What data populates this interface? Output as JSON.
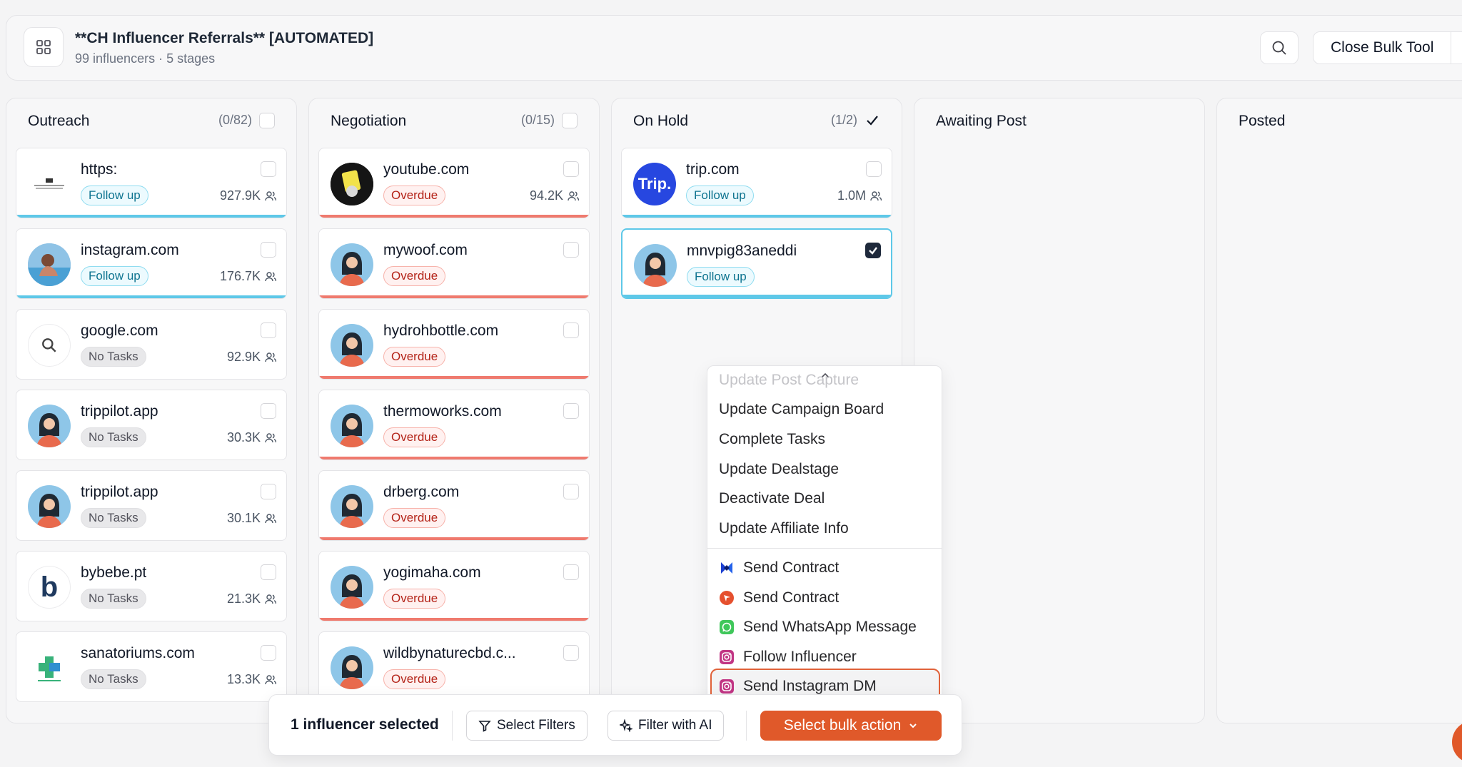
{
  "header": {
    "title": "**CH Influencer Referrals** [AUTOMATED]",
    "subtitle": "99 influencers · 5 stages",
    "close_label": "Close Bulk Tool"
  },
  "columns": [
    {
      "title": "Outreach",
      "count": "(0/82)"
    },
    {
      "title": "Negotiation",
      "count": "(0/15)"
    },
    {
      "title": "On Hold",
      "count": "(1/2)"
    },
    {
      "title": "Awaiting Post",
      "count": ""
    },
    {
      "title": "Posted",
      "count": ""
    }
  ],
  "outreach": [
    {
      "name": "https:",
      "status": "Follow up",
      "followers": "927.9K"
    },
    {
      "name": "instagram.com",
      "status": "Follow up",
      "followers": "176.7K"
    },
    {
      "name": "google.com",
      "status": "No Tasks",
      "followers": "92.9K"
    },
    {
      "name": "trippilot.app",
      "status": "No Tasks",
      "followers": "30.3K"
    },
    {
      "name": "trippilot.app",
      "status": "No Tasks",
      "followers": "30.1K"
    },
    {
      "name": "bybebe.pt",
      "status": "No Tasks",
      "followers": "21.3K"
    },
    {
      "name": "sanatoriums.com",
      "status": "No Tasks",
      "followers": "13.3K"
    }
  ],
  "negotiation": [
    {
      "name": "youtube.com",
      "status": "Overdue",
      "followers": "94.2K"
    },
    {
      "name": "mywoof.com",
      "status": "Overdue",
      "followers": ""
    },
    {
      "name": "hydrohbottle.com",
      "status": "Overdue",
      "followers": ""
    },
    {
      "name": "thermoworks.com",
      "status": "Overdue",
      "followers": ""
    },
    {
      "name": "drberg.com",
      "status": "Overdue",
      "followers": ""
    },
    {
      "name": "yogimaha.com",
      "status": "Overdue",
      "followers": ""
    },
    {
      "name": "wildbynaturecbd.c...",
      "status": "Overdue",
      "followers": ""
    }
  ],
  "on_hold": [
    {
      "name": "trip.com",
      "status": "Follow up",
      "followers": "1.0M"
    },
    {
      "name": "mnvpig83aneddi",
      "status": "Follow up",
      "followers": ""
    }
  ],
  "avatar_text": {
    "trip": "Trip.",
    "bybebe": "b"
  },
  "menu": {
    "items": [
      "Update Post Capture",
      "Update Campaign Board",
      "Complete Tasks",
      "Update Dealstage",
      "Deactivate Deal",
      "Update Affiliate Info",
      "Send Contract",
      "Send Contract",
      "Send WhatsApp Message",
      "Follow Influencer",
      "Send Instagram DM"
    ]
  },
  "bottom": {
    "selected": "1 influencer selected",
    "filters": "Select Filters",
    "ai": "Filter with AI",
    "bulk": "Select bulk action"
  },
  "colors": {
    "accent": "#e0592a",
    "follow": "#5ec8e8",
    "overdue": "#ef7a6e"
  }
}
